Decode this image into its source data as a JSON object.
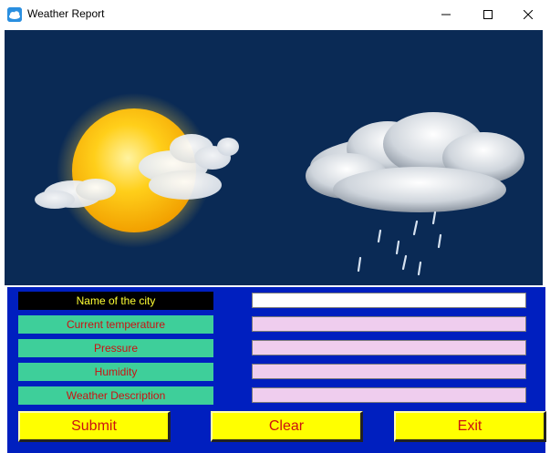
{
  "window": {
    "title": "Weather Report",
    "icons": {
      "app": "weather-app-icon",
      "minimize": "minimize-icon",
      "maximize": "maximize-icon",
      "close": "close-icon"
    }
  },
  "image": {
    "icons": [
      "sun-with-clouds-icon",
      "rain-cloud-icon"
    ]
  },
  "form": {
    "labels": {
      "city": "Name of the city",
      "temperature": "Current temperature",
      "pressure": "Pressure",
      "humidity": "Humidity",
      "description": "Weather Description"
    },
    "values": {
      "city": "",
      "temperature": "",
      "pressure": "",
      "humidity": "",
      "description": ""
    }
  },
  "buttons": {
    "submit": "Submit",
    "clear": "Clear",
    "exit": "Exit"
  },
  "colors": {
    "panel_bg": "#001fbf",
    "label_black": "#000000",
    "label_green": "#3ecf9a",
    "label_text_yellow": "#ffff33",
    "label_text_red": "#cc1111",
    "field_pink": "#efcdee",
    "button_yellow": "#ffff00",
    "image_bg": "#0a2a55"
  }
}
